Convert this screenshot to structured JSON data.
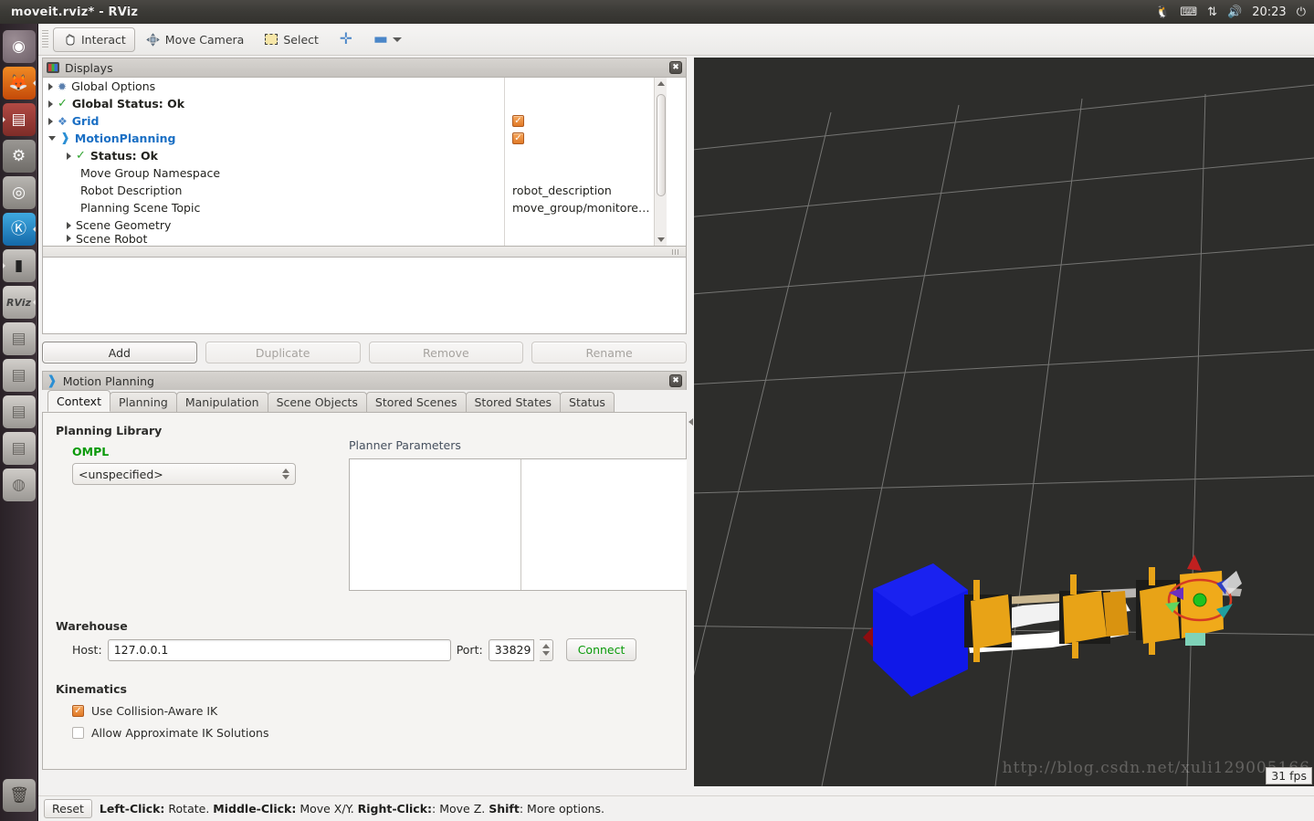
{
  "window": {
    "title": "moveit.rviz* - RViz"
  },
  "tray": {
    "items": [
      {
        "name": "tux-indicator-icon",
        "glyph": "🐧"
      },
      {
        "name": "keyboard-indicator-icon",
        "glyph": "⌨"
      },
      {
        "name": "network-indicator-icon",
        "glyph": "⇅"
      },
      {
        "name": "volume-indicator-icon",
        "glyph": "🔊"
      }
    ],
    "clock": "20:23",
    "power_glyph": "⏻"
  },
  "launcher": {
    "items": [
      {
        "name": "ubuntu-dash-icon",
        "glyph": "◉",
        "cls": "li-ubuntu",
        "running": false
      },
      {
        "name": "firefox-icon",
        "glyph": "🦊",
        "cls": "li-firefox",
        "running": true
      },
      {
        "name": "files-icon",
        "glyph": "▤",
        "cls": "li-files",
        "running": true
      },
      {
        "name": "settings-icon",
        "glyph": "⚙",
        "cls": "li-settings",
        "running": false
      },
      {
        "name": "camera-icon",
        "glyph": "◎",
        "cls": "li-camera",
        "running": false
      },
      {
        "name": "kdenlive-icon",
        "glyph": "K",
        "cls": "li-k",
        "running": true
      },
      {
        "name": "terminal-icon",
        "glyph": "▮",
        "cls": "li-term",
        "running": true
      },
      {
        "name": "rviz-icon",
        "glyph": "RViz",
        "cls": "li-rviz",
        "running": true
      },
      {
        "name": "disk-drive-icon-1",
        "glyph": "▭",
        "cls": "li-disk",
        "running": false
      },
      {
        "name": "disk-drive-icon-2",
        "glyph": "▭",
        "cls": "li-disk",
        "running": false
      },
      {
        "name": "disk-drive-icon-3",
        "glyph": "▭",
        "cls": "li-disk",
        "running": false
      },
      {
        "name": "disk-drive-icon-4",
        "glyph": "▭",
        "cls": "li-disk",
        "running": false
      },
      {
        "name": "cd-drive-icon",
        "glyph": "◍",
        "cls": "li-cd",
        "running": false
      }
    ],
    "trash": {
      "name": "trash-icon",
      "glyph": "🗑"
    }
  },
  "toolbar": {
    "interact_label": "Interact",
    "move_camera_label": "Move Camera",
    "select_label": "Select",
    "plus_label": "+",
    "minus_label": "−"
  },
  "displays": {
    "title": "Displays",
    "rows": [
      {
        "label": "Global Options",
        "icon": "gear",
        "arrow": "right",
        "indent": 0,
        "style": "plain"
      },
      {
        "label": "Global Status: Ok",
        "icon": "check",
        "arrow": "right",
        "indent": 0,
        "style": "bold"
      },
      {
        "label": "Grid",
        "icon": "grid",
        "arrow": "right",
        "indent": 0,
        "style": "blue"
      },
      {
        "label": "MotionPlanning",
        "icon": "mpl",
        "arrow": "down",
        "indent": 0,
        "style": "blue"
      },
      {
        "label": "Status: Ok",
        "icon": "check",
        "arrow": "right",
        "indent": 1,
        "style": "bold"
      },
      {
        "label": "Move Group Namespace",
        "icon": "none",
        "arrow": "none",
        "indent": 1,
        "style": "plain"
      },
      {
        "label": "Robot Description",
        "icon": "none",
        "arrow": "none",
        "indent": 1,
        "style": "plain"
      },
      {
        "label": "Planning Scene Topic",
        "icon": "none",
        "arrow": "none",
        "indent": 1,
        "style": "plain"
      },
      {
        "label": "Scene Geometry",
        "icon": "none",
        "arrow": "right",
        "indent": 1,
        "style": "plain"
      },
      {
        "label": "Scene Robot",
        "icon": "none",
        "arrow": "right",
        "indent": 1,
        "style": "plain"
      }
    ],
    "values": [
      {
        "type": "blank",
        "value": ""
      },
      {
        "type": "blank",
        "value": ""
      },
      {
        "type": "checkbox",
        "checked": true,
        "value": ""
      },
      {
        "type": "checkbox",
        "checked": true,
        "value": ""
      },
      {
        "type": "blank",
        "value": ""
      },
      {
        "type": "blank",
        "value": ""
      },
      {
        "type": "text",
        "value": "robot_description"
      },
      {
        "type": "text",
        "value": "move_group/monitore…"
      },
      {
        "type": "blank",
        "value": ""
      },
      {
        "type": "blank",
        "value": ""
      }
    ]
  },
  "actions": {
    "add_label": "Add",
    "duplicate_label": "Duplicate",
    "remove_label": "Remove",
    "rename_label": "Rename"
  },
  "motion_planning": {
    "title": "Motion Planning",
    "tabs": [
      {
        "label": "Context",
        "active": true
      },
      {
        "label": "Planning",
        "active": false
      },
      {
        "label": "Manipulation",
        "active": false
      },
      {
        "label": "Scene Objects",
        "active": false
      },
      {
        "label": "Stored Scenes",
        "active": false
      },
      {
        "label": "Stored States",
        "active": false
      },
      {
        "label": "Status",
        "active": false
      }
    ],
    "context": {
      "planning_library_label": "Planning Library",
      "ompl_label": "OMPL",
      "planner_value": "<unspecified>",
      "planner_parameters_label": "Planner Parameters",
      "planner_parameters_rows": [],
      "warehouse_label": "Warehouse",
      "host_label": "Host:",
      "host_value": "127.0.0.1",
      "port_label": "Port:",
      "port_value": "33829",
      "connect_label": "Connect",
      "kinematics_label": "Kinematics",
      "collision_aware_label": "Use Collision-Aware IK",
      "collision_aware_checked": true,
      "approximate_ik_label": "Allow Approximate IK Solutions",
      "approximate_ik_checked": false
    }
  },
  "view3d": {
    "watermark": "http://blog.csdn.net/xuli129005166",
    "fps": "31 fps"
  },
  "statusbar": {
    "reset_label": "Reset",
    "hint_parts": [
      {
        "text": "Left-Click:",
        "bold": true
      },
      {
        "text": " Rotate. ",
        "bold": false
      },
      {
        "text": "Middle-Click:",
        "bold": true
      },
      {
        "text": " Move X/Y. ",
        "bold": false
      },
      {
        "text": "Right-Click:",
        "bold": true
      },
      {
        "text": ": Move Z. ",
        "bold": false
      },
      {
        "text": "Shift",
        "bold": true
      },
      {
        "text": ": More options.",
        "bold": false
      }
    ]
  },
  "colors": {
    "accent_blue": "#1a6fc4",
    "ok_green": "#0a9a0a",
    "checkbox_orange": "#e07a28",
    "viewport_bg": "#2d2d2b",
    "panel_bg": "#f2f1f0"
  }
}
